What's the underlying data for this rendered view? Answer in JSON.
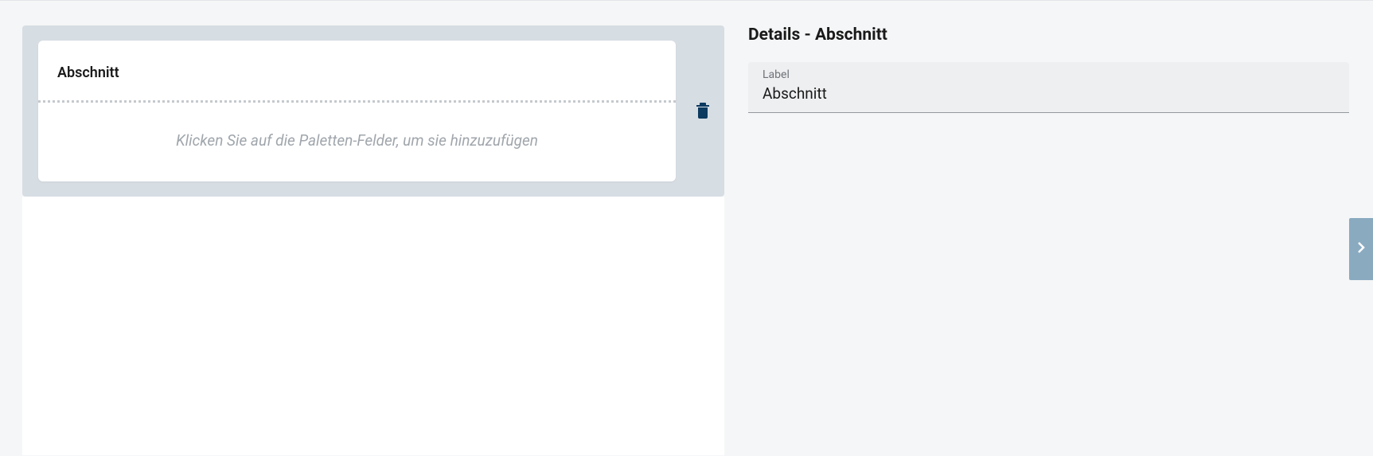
{
  "canvas": {
    "section_title": "Abschnitt",
    "placeholder_text": "Klicken Sie auf die Paletten-Felder, um sie hinzuzufügen"
  },
  "details": {
    "title": "Details - Abschnitt",
    "label_field": {
      "label": "Label",
      "value": "Abschnitt"
    }
  }
}
